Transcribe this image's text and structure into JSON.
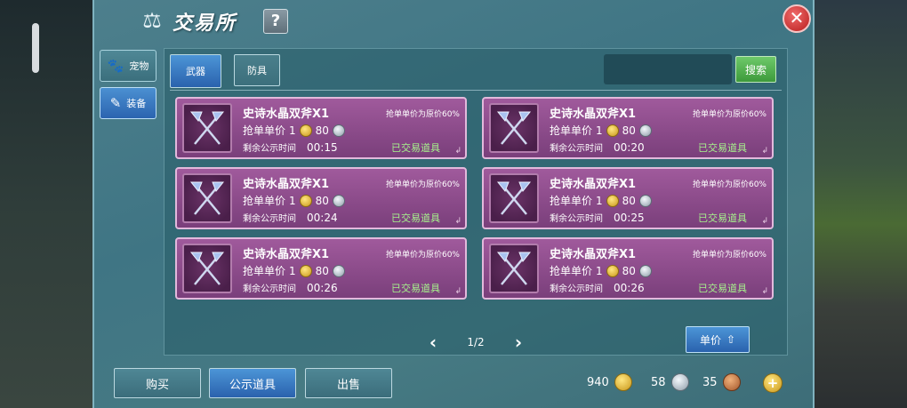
{
  "window": {
    "title": "交易所",
    "help_label": "?",
    "close_label": "✕"
  },
  "sidebar": {
    "items": [
      {
        "label": "宠物",
        "icon": "paw-icon"
      },
      {
        "label": "装备",
        "icon": "equipment-icon"
      }
    ]
  },
  "tabs": [
    {
      "label": "武器"
    },
    {
      "label": "防具"
    }
  ],
  "search": {
    "placeholder": "",
    "button_label": "搜索"
  },
  "items": [
    {
      "name": "史诗水晶双斧X1",
      "note": "抢单单价为原价60%",
      "price_label": "抢单单价",
      "gold": "1",
      "silver": "80",
      "time_label": "剩余公示时间",
      "time": "00:15",
      "status": "已交易道具"
    },
    {
      "name": "史诗水晶双斧X1",
      "note": "抢单单价为原价60%",
      "price_label": "抢单单价",
      "gold": "1",
      "silver": "80",
      "time_label": "剩余公示时间",
      "time": "00:20",
      "status": "已交易道具"
    },
    {
      "name": "史诗水晶双斧X1",
      "note": "抢单单价为原价60%",
      "price_label": "抢单单价",
      "gold": "1",
      "silver": "80",
      "time_label": "剩余公示时间",
      "time": "00:24",
      "status": "已交易道具"
    },
    {
      "name": "史诗水晶双斧X1",
      "note": "抢单单价为原价60%",
      "price_label": "抢单单价",
      "gold": "1",
      "silver": "80",
      "time_label": "剩余公示时间",
      "time": "00:25",
      "status": "已交易道具"
    },
    {
      "name": "史诗水晶双斧X1",
      "note": "抢单单价为原价60%",
      "price_label": "抢单单价",
      "gold": "1",
      "silver": "80",
      "time_label": "剩余公示时间",
      "time": "00:26",
      "status": "已交易道具"
    },
    {
      "name": "史诗水晶双斧X1",
      "note": "抢单单价为原价60%",
      "price_label": "抢单单价",
      "gold": "1",
      "silver": "80",
      "time_label": "剩余公示时间",
      "time": "00:26",
      "status": "已交易道具"
    }
  ],
  "pager": {
    "prev": "‹",
    "page": "1/2",
    "next": "›"
  },
  "sort": {
    "label": "单价"
  },
  "bottom_tabs": [
    {
      "label": "购买"
    },
    {
      "label": "公示道具"
    },
    {
      "label": "出售"
    }
  ],
  "currency": {
    "gold": "940",
    "silver": "58",
    "bronze": "35"
  },
  "colors": {
    "accent": "#2a62ad",
    "item_card": "#7a3f7b",
    "status_green": "#a6f28c",
    "close": "#b81e1e"
  }
}
